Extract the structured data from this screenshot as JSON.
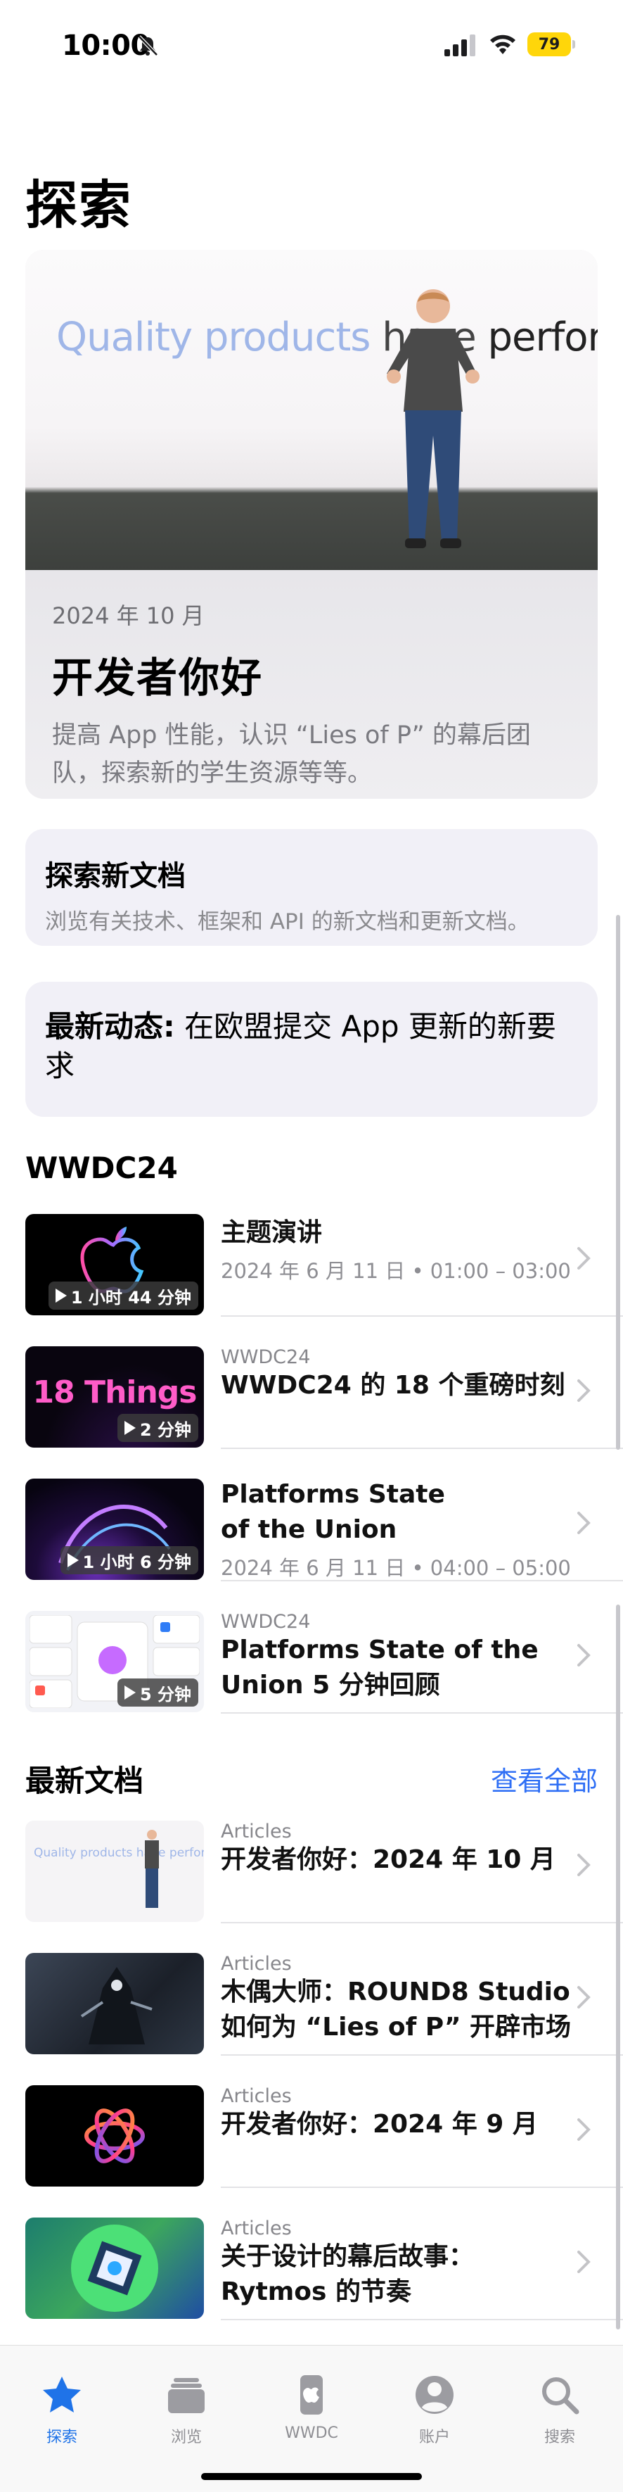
{
  "status": {
    "time": "10:00",
    "battery": "79"
  },
  "page": {
    "title": "探索"
  },
  "hero": {
    "slogan_q": "Quality products",
    "slogan_h": " have ",
    "slogan_p": "performance",
    "date": "2024 年 10 月",
    "title": "开发者你好",
    "desc": "提高 App 性能，认识 “Lies of P” 的幕后团队，探索新的学生资源等等。"
  },
  "card_docs": {
    "title": "探索新文档",
    "subtitle": "浏览有关技术、框架和 API 的新文档和更新文档。"
  },
  "card_news": {
    "prefix": "最新动态:",
    "text": " 在欧盟提交 App 更新的新要求"
  },
  "wwdc": {
    "section_title": "WWDC24",
    "items": [
      {
        "kicker": "",
        "title": "主题演讲",
        "subtitle": "2024 年 6 月 11 日 • 01:00 – 03:00",
        "duration": "1 小时 44 分钟",
        "thumb_text": ""
      },
      {
        "kicker": "WWDC24",
        "title": "WWDC24 的 18 个重磅时刻",
        "subtitle": "",
        "duration": "2 分钟",
        "thumb_text": "18 Things"
      },
      {
        "kicker": "",
        "title": "Platforms State of the Union",
        "subtitle": "2024 年 6 月 11 日 • 04:00 – 05:00",
        "duration": "1 小时 6 分钟",
        "thumb_text": ""
      },
      {
        "kicker": "WWDC24",
        "title": "Platforms State of the Union 5 分钟回顾",
        "subtitle": "",
        "duration": "5 分钟",
        "thumb_text": ""
      }
    ]
  },
  "latest": {
    "section_title": "最新文档",
    "see_all": "查看全部",
    "items": [
      {
        "kicker": "Articles",
        "title": "开发者你好：2024 年 10 月"
      },
      {
        "kicker": "Articles",
        "title": "木偶大师：ROUND8 Studio 如何为 “Lies of P” 开辟市场"
      },
      {
        "kicker": "Articles",
        "title": "开发者你好：2024 年 9 月"
      },
      {
        "kicker": "Articles",
        "title": "关于设计的幕后故事：Rytmos 的节奏"
      }
    ]
  },
  "tabs": [
    {
      "label": "探索",
      "icon": "star-icon",
      "active": true
    },
    {
      "label": "浏览",
      "icon": "stack-icon",
      "active": false
    },
    {
      "label": "WWDC",
      "icon": "wwdc-icon",
      "active": false
    },
    {
      "label": "账户",
      "icon": "person-icon",
      "active": false
    },
    {
      "label": "搜索",
      "icon": "search-icon",
      "active": false
    }
  ],
  "colors": {
    "accent": "#1f73e8",
    "link": "#2f6ff5",
    "card_bg": "#f1f0f7",
    "battery": "#ffd60a"
  }
}
